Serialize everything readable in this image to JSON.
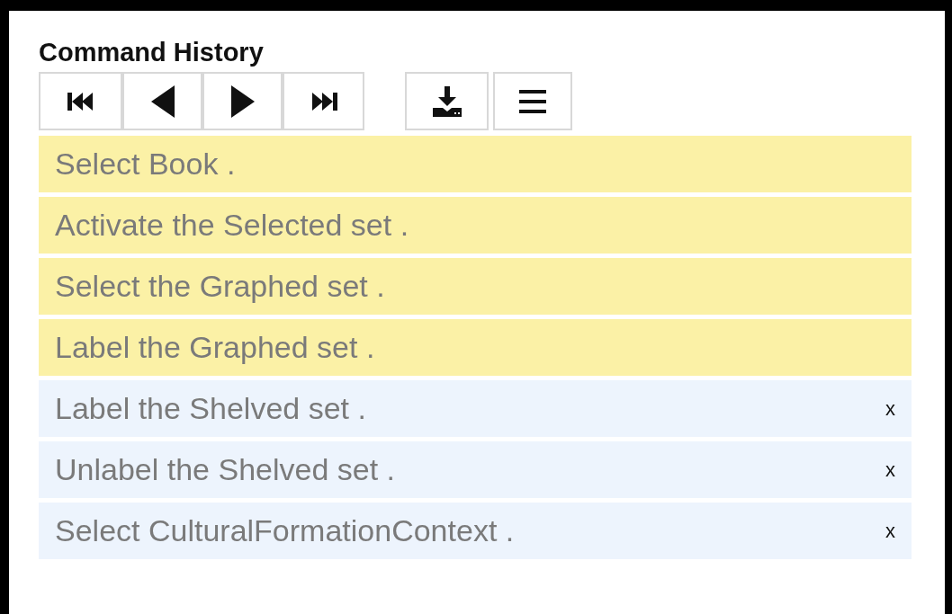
{
  "panel": {
    "title": "Command History"
  },
  "toolbar": {
    "navigation": [
      {
        "kind": "first"
      },
      {
        "kind": "previous"
      },
      {
        "kind": "next"
      },
      {
        "kind": "last"
      }
    ],
    "actions": [
      {
        "kind": "download"
      },
      {
        "kind": "menu"
      }
    ]
  },
  "history": [
    {
      "text": "Select Book .",
      "undone": false
    },
    {
      "text": "Activate the Selected set .",
      "undone": false
    },
    {
      "text": "Select the Graphed set .",
      "undone": false
    },
    {
      "text": "Label the Graphed set .",
      "undone": false
    },
    {
      "text": "Label the Shelved set .",
      "undone": true,
      "remove": "x"
    },
    {
      "text": "Unlabel the Shelved set .",
      "undone": true,
      "remove": "x"
    },
    {
      "text": "Select CulturalFormationContext .",
      "undone": true,
      "remove": "x"
    }
  ]
}
